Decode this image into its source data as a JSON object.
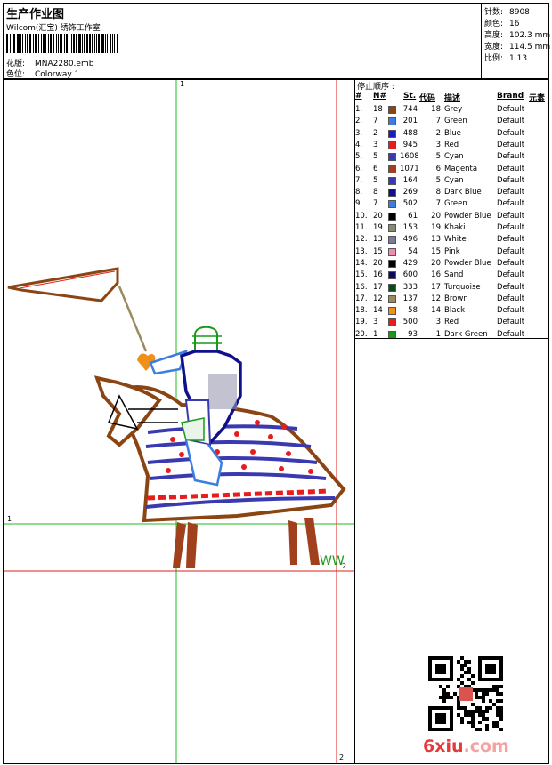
{
  "header": {
    "title": "生产作业图",
    "company": "Wilcom(汇宝) 绣饰工作室",
    "design_label": "花版:",
    "design_value": "MNA2280.emb",
    "colorway_label": "色位:",
    "colorway_value": "Colorway 1"
  },
  "stats": [
    {
      "label": "针数:",
      "value": "8908"
    },
    {
      "label": "颜色:",
      "value": "16"
    },
    {
      "label": "高度:",
      "value": "102.3 mm"
    },
    {
      "label": "宽度:",
      "value": "114.5 mm"
    },
    {
      "label": "比例:",
      "value": "1.13"
    }
  ],
  "legend": {
    "title": "停止顺序 :",
    "headers": {
      "num": "#",
      "n": "N#",
      "st": "St.",
      "code": "代码",
      "desc": "描述",
      "brand": "Brand",
      "elem": "元素"
    },
    "rows": [
      {
        "num": "1.",
        "n": "18",
        "color": "#8B4513",
        "st": "744",
        "code": "18",
        "desc": "Grey",
        "brand": "Default"
      },
      {
        "num": "2.",
        "n": "7",
        "color": "#3c7de0",
        "st": "201",
        "code": "7",
        "desc": "Green",
        "brand": "Default"
      },
      {
        "num": "3.",
        "n": "2",
        "color": "#1a1acc",
        "st": "488",
        "code": "2",
        "desc": "Blue",
        "brand": "Default"
      },
      {
        "num": "4.",
        "n": "3",
        "color": "#e81c1c",
        "st": "945",
        "code": "3",
        "desc": "Red",
        "brand": "Default"
      },
      {
        "num": "5.",
        "n": "5",
        "color": "#3a3ab0",
        "st": "1608",
        "code": "5",
        "desc": "Cyan",
        "brand": "Default"
      },
      {
        "num": "6.",
        "n": "6",
        "color": "#a0401c",
        "st": "1071",
        "code": "6",
        "desc": "Magenta",
        "brand": "Default"
      },
      {
        "num": "7.",
        "n": "5",
        "color": "#3a3ab0",
        "st": "164",
        "code": "5",
        "desc": "Cyan",
        "brand": "Default"
      },
      {
        "num": "8.",
        "n": "8",
        "color": "#10108a",
        "st": "269",
        "code": "8",
        "desc": "Dark Blue",
        "brand": "Default"
      },
      {
        "num": "9.",
        "n": "7",
        "color": "#3c7de0",
        "st": "502",
        "code": "7",
        "desc": "Green",
        "brand": "Default"
      },
      {
        "num": "10.",
        "n": "20",
        "color": "#000000",
        "st": "61",
        "code": "20",
        "desc": "Powder Blue",
        "brand": "Default"
      },
      {
        "num": "11.",
        "n": "19",
        "color": "#8a8a70",
        "st": "153",
        "code": "19",
        "desc": "Khaki",
        "brand": "Default"
      },
      {
        "num": "12.",
        "n": "13",
        "color": "#7a7a9a",
        "st": "496",
        "code": "13",
        "desc": "White",
        "brand": "Default"
      },
      {
        "num": "13.",
        "n": "15",
        "color": "#f08cb0",
        "st": "54",
        "code": "15",
        "desc": "Pink",
        "brand": "Default"
      },
      {
        "num": "14.",
        "n": "20",
        "color": "#000000",
        "st": "429",
        "code": "20",
        "desc": "Powder Blue",
        "brand": "Default"
      },
      {
        "num": "15.",
        "n": "16",
        "color": "#0a0a60",
        "st": "600",
        "code": "16",
        "desc": "Sand",
        "brand": "Default"
      },
      {
        "num": "16.",
        "n": "17",
        "color": "#0a4a1a",
        "st": "333",
        "code": "17",
        "desc": "Turquoise",
        "brand": "Default"
      },
      {
        "num": "17.",
        "n": "12",
        "color": "#9a8a60",
        "st": "137",
        "code": "12",
        "desc": "Brown",
        "brand": "Default"
      },
      {
        "num": "18.",
        "n": "14",
        "color": "#f0901a",
        "st": "58",
        "code": "14",
        "desc": "Black",
        "brand": "Default"
      },
      {
        "num": "19.",
        "n": "3",
        "color": "#e81c1c",
        "st": "500",
        "code": "3",
        "desc": "Red",
        "brand": "Default"
      },
      {
        "num": "20.",
        "n": "1",
        "color": "#1a9a1a",
        "st": "93",
        "code": "1",
        "desc": "Dark Green",
        "brand": "Default"
      }
    ]
  },
  "canvas": {
    "axis_labels": {
      "top": "1",
      "left": "1",
      "right_mid": "2",
      "bottom": "2"
    },
    "signature": "WW"
  },
  "watermark": {
    "text_a": "6xiu",
    "text_b": ".com"
  }
}
